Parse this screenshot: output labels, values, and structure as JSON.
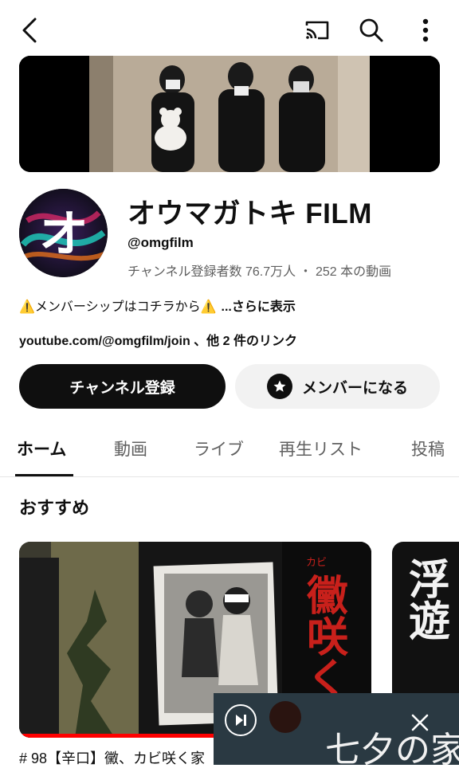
{
  "channel": {
    "title": "オウマガトキ FILM",
    "handle": "@omgfilm",
    "stats": "チャンネル登録者数 76.7万人 ・ 252 本の動画",
    "avatar_glyph": "オ",
    "description": "⚠️メンバーシップはコチラから⚠️",
    "more_label": "...さらに表示",
    "links": "youtube.com/@omgfilm/join 、他 2 件のリンク"
  },
  "buttons": {
    "subscribe": "チャンネル登録",
    "member": "メンバーになる"
  },
  "tabs": [
    {
      "label": "ホーム"
    },
    {
      "label": "動画"
    },
    {
      "label": "ライブ"
    },
    {
      "label": "再生リスト"
    },
    {
      "label": "投稿"
    }
  ],
  "section": {
    "title": "おすすめ"
  },
  "featured": {
    "title": "# 98【辛口】黴、カビ咲く家",
    "thumb_text": "黴咲く家",
    "thumb_ruby": "カビ"
  },
  "next_card": {
    "thumb_text": "浮遊"
  },
  "miniplayer": {
    "title": "七夕の家"
  },
  "icons": {
    "back": "back-arrow-icon",
    "cast": "cast-icon",
    "search": "search-icon",
    "more": "more-vert-icon",
    "star": "star-icon",
    "close": "close-icon",
    "play_pause": "play-pause-icon"
  },
  "colors": {
    "accent": "#0f0f0f",
    "progress": "#ff0000",
    "thumb_red": "#c8201b"
  }
}
